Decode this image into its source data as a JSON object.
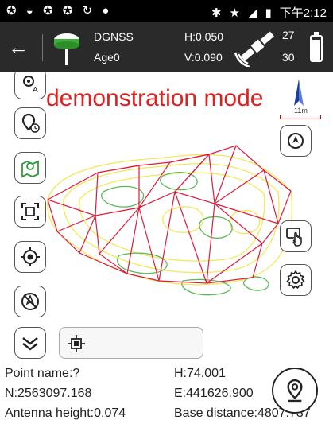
{
  "status_bar": {
    "left_icons": [
      "app-icon",
      "wifi-icon",
      "app-icon",
      "app-icon",
      "sync-icon",
      "debug-icon"
    ],
    "right_icons": [
      "bluetooth-icon",
      "star-icon",
      "signal-icon",
      "battery-icon"
    ],
    "time": "下午2:12"
  },
  "header": {
    "back_icon": "arrow-left-icon",
    "device_icon": "gnss-receiver-icon",
    "fix_type": "DGNSS",
    "age": "Age0",
    "h_precision": "H:0.050",
    "v_precision": "V:0.090",
    "satellite_icon": "satellite-icon",
    "sats_tracked": "27",
    "sats_used": "30",
    "battery_level": 0.9
  },
  "map": {
    "watermark": "demonstration mode",
    "scale_label": "11m",
    "north_icon": "north-arrow-icon",
    "colors": {
      "tin_edge": "#e01a3a",
      "contour_yellow": "#f2e85a",
      "contour_green": "#5bb85b",
      "watermark": "#e02020"
    }
  },
  "left_toolbar": [
    {
      "name": "layer-label-icon"
    },
    {
      "name": "point-history-icon"
    },
    {
      "name": "map-pin-icon"
    },
    {
      "name": "zoom-extent-icon"
    },
    {
      "name": "crosshair-icon"
    },
    {
      "name": "navigation-off-icon"
    },
    {
      "name": "expand-more-icon"
    }
  ],
  "right_toolbar": [
    {
      "name": "locate-icon"
    },
    {
      "name": "touch-select-icon"
    },
    {
      "name": "settings-icon"
    }
  ],
  "bottom_panel_icon": "receiver-chip-icon",
  "info": {
    "point_name": "Point name:?",
    "northing": "N:2563097.168",
    "antenna_height": "Antenna height:0.074",
    "height": "H:74.001",
    "easting": "E:441626.900",
    "base_distance": "Base distance:4807.737",
    "collect_icon": "collect-point-icon"
  }
}
